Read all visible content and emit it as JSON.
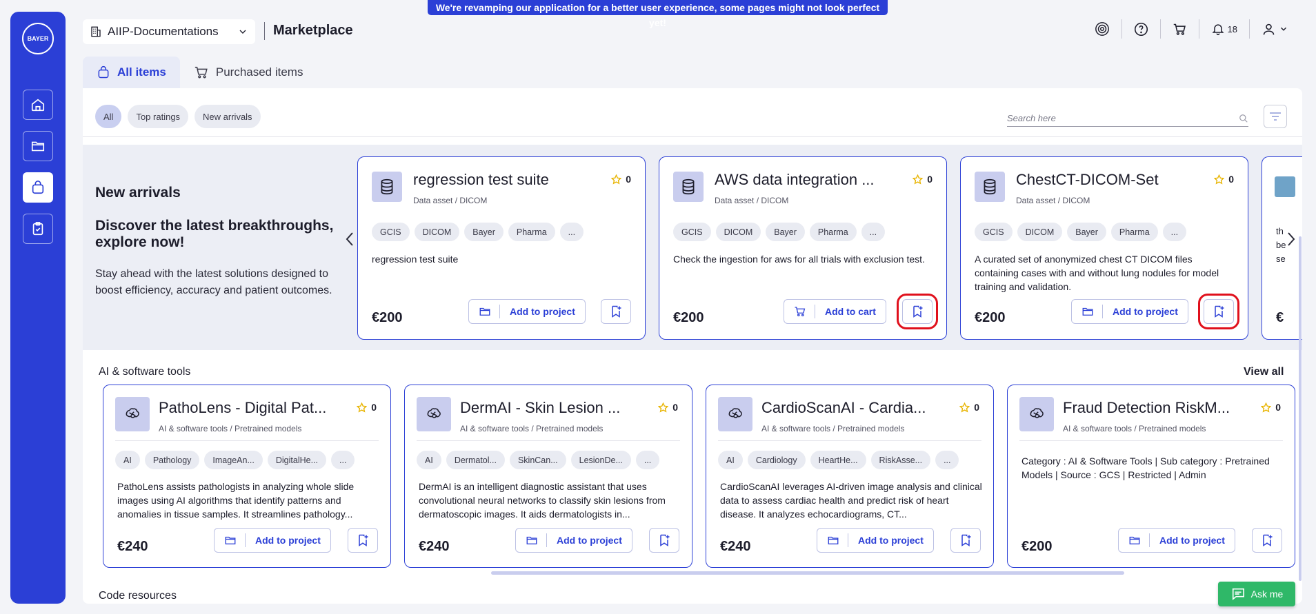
{
  "banner": "We're revamping our application for a better user experience, some pages might not look perfect yet!",
  "rail": {
    "logo_h": "BAYER",
    "logo_v": "BAYER"
  },
  "header": {
    "workspace": "AIIP-Documentations",
    "title": "Marketplace",
    "notifications_count": "18"
  },
  "tabs": [
    {
      "label": "All items",
      "active": true
    },
    {
      "label": "Purchased items",
      "active": false
    }
  ],
  "filters": [
    {
      "label": "All",
      "active": true
    },
    {
      "label": "Top ratings"
    },
    {
      "label": "New arrivals"
    }
  ],
  "search": {
    "placeholder": "Search here"
  },
  "promo": {
    "heading": "New arrivals",
    "subheading": "Discover the latest breakthroughs, explore now!",
    "text": "Stay ahead with the latest solutions designed to boost efficiency, accuracy and patient outcomes."
  },
  "new_arrivals": [
    {
      "title": "regression test suite",
      "rating": "0",
      "subtitle": "Data asset / DICOM",
      "tags": [
        "GCIS",
        "DICOM",
        "Bayer",
        "Pharma",
        "..."
      ],
      "description": "regression test suite",
      "price": "€200",
      "action": "Add to project"
    },
    {
      "title": "AWS data integration ...",
      "rating": "0",
      "subtitle": "Data asset / DICOM",
      "tags": [
        "GCIS",
        "DICOM",
        "Bayer",
        "Pharma",
        "..."
      ],
      "description": "Check the ingestion for aws for all trials with exclusion test.",
      "price": "€200",
      "action": "Add to cart"
    },
    {
      "title": "ChestCT-DICOM-Set",
      "rating": "0",
      "subtitle": "Data asset / DICOM",
      "tags": [
        "GCIS",
        "DICOM",
        "Bayer",
        "Pharma",
        "..."
      ],
      "description": "A curated set of anonymized chest CT DICOM files containing cases with and without lung nodules for model training and validation.",
      "price": "€200",
      "action": "Add to project"
    },
    {
      "partial_text": [
        "th",
        "be",
        "se"
      ],
      "partial_price": "€"
    }
  ],
  "ai_section": {
    "title": "AI & software tools",
    "view_all": "View all",
    "cards": [
      {
        "title": "PathoLens - Digital Pat...",
        "rating": "0",
        "subtitle": "AI & software tools / Pretrained models",
        "tags": [
          "AI",
          "Pathology",
          "ImageAn...",
          "DigitalHe...",
          "..."
        ],
        "description": "PathoLens assists pathologists in analyzing whole slide images using AI algorithms that identify patterns and anomalies in tissue samples. It streamlines pathology...",
        "price": "€240",
        "action": "Add to project"
      },
      {
        "title": "DermAI - Skin Lesion ...",
        "rating": "0",
        "subtitle": "AI & software tools / Pretrained models",
        "tags": [
          "AI",
          "Dermatol...",
          "SkinCan...",
          "LesionDe...",
          "..."
        ],
        "description": "DermAI is an intelligent diagnostic assistant that uses convolutional neural networks to classify skin lesions from dermatoscopic images. It aids dermatologists in...",
        "price": "€240",
        "action": "Add to project"
      },
      {
        "title": "CardioScanAI - Cardia...",
        "rating": "0",
        "subtitle": "AI & software tools / Pretrained models",
        "tags": [
          "AI",
          "Cardiology",
          "HeartHe...",
          "RiskAsse...",
          "..."
        ],
        "description": "CardioScanAI leverages AI-driven image analysis and clinical data to assess cardiac health and predict risk of heart disease. It analyzes echocardiograms, CT...",
        "price": "€240",
        "action": "Add to project"
      },
      {
        "title": "Fraud Detection RiskM...",
        "rating": "0",
        "subtitle": "AI & software tools / Pretrained models",
        "tags": [],
        "description": "Category : AI & Software Tools | Sub category : Pretrained Models | Source : GCS | Restricted | Admin",
        "price": "€200",
        "action": "Add to project"
      }
    ]
  },
  "code_section": {
    "title": "Code resources"
  },
  "askme": "Ask me",
  "colors": {
    "primary": "#2b3fd6",
    "highlight": "#e0101c",
    "askme": "#2fb868"
  }
}
